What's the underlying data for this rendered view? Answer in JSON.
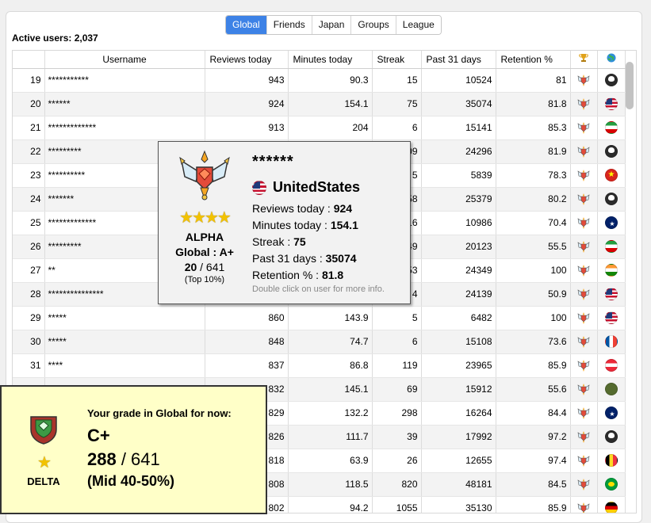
{
  "tabs": [
    "Global",
    "Friends",
    "Japan",
    "Groups",
    "League"
  ],
  "active_tab": 0,
  "active_users": "Active users: 2,037",
  "columns": [
    "",
    "Username",
    "Reviews today",
    "Minutes today",
    "Streak",
    "Past 31 days",
    "Retention %",
    "trophy-icon",
    "globe-icon"
  ],
  "rows": [
    {
      "rank": "19",
      "user": "***********",
      "reviews": "943",
      "minutes": "90.3",
      "streak": "15",
      "past31": "10524",
      "retention": "81",
      "flag": "pirate"
    },
    {
      "rank": "20",
      "user": "******",
      "reviews": "924",
      "minutes": "154.1",
      "streak": "75",
      "past31": "35074",
      "retention": "81.8",
      "flag": "us"
    },
    {
      "rank": "21",
      "user": "*************",
      "reviews": "913",
      "minutes": "204",
      "streak": "6",
      "past31": "15141",
      "retention": "85.3",
      "flag": "iran"
    },
    {
      "rank": "22",
      "user": "*********",
      "reviews": "",
      "minutes": "",
      "streak": "09",
      "past31": "24296",
      "retention": "81.9",
      "flag": "pirate"
    },
    {
      "rank": "23",
      "user": "**********",
      "reviews": "",
      "minutes": "",
      "streak": "5",
      "past31": "5839",
      "retention": "78.3",
      "flag": "vietnam"
    },
    {
      "rank": "24",
      "user": "*******",
      "reviews": "",
      "minutes": "",
      "streak": "58",
      "past31": "25379",
      "retention": "80.2",
      "flag": "pirate"
    },
    {
      "rank": "25",
      "user": "*************",
      "reviews": "",
      "minutes": "",
      "streak": "16",
      "past31": "10986",
      "retention": "70.4",
      "flag": "australia"
    },
    {
      "rank": "26",
      "user": "*********",
      "reviews": "",
      "minutes": "",
      "streak": "49",
      "past31": "20123",
      "retention": "55.5",
      "flag": "iran"
    },
    {
      "rank": "27",
      "user": "**",
      "reviews": "",
      "minutes": "",
      "streak": "53",
      "past31": "24349",
      "retention": "100",
      "flag": "india"
    },
    {
      "rank": "28",
      "user": "***************",
      "reviews": "",
      "minutes": "",
      "streak": "4",
      "past31": "24139",
      "retention": "50.9",
      "flag": "us"
    },
    {
      "rank": "29",
      "user": "*****",
      "reviews": "860",
      "minutes": "143.9",
      "streak": "5",
      "past31": "6482",
      "retention": "100",
      "flag": "us"
    },
    {
      "rank": "30",
      "user": "*****",
      "reviews": "848",
      "minutes": "74.7",
      "streak": "6",
      "past31": "15108",
      "retention": "73.6",
      "flag": "france"
    },
    {
      "rank": "31",
      "user": "****",
      "reviews": "837",
      "minutes": "86.8",
      "streak": "119",
      "past31": "23965",
      "retention": "85.9",
      "flag": "austria"
    },
    {
      "rank": "",
      "user": "",
      "reviews": "832",
      "minutes": "145.1",
      "streak": "69",
      "past31": "15912",
      "retention": "55.6",
      "flag": "army"
    },
    {
      "rank": "",
      "user": "",
      "reviews": "829",
      "minutes": "132.2",
      "streak": "298",
      "past31": "16264",
      "retention": "84.4",
      "flag": "australia"
    },
    {
      "rank": "",
      "user": "",
      "reviews": "826",
      "minutes": "111.7",
      "streak": "39",
      "past31": "17992",
      "retention": "97.2",
      "flag": "pirate"
    },
    {
      "rank": "",
      "user": "",
      "reviews": "818",
      "minutes": "63.9",
      "streak": "26",
      "past31": "12655",
      "retention": "97.4",
      "flag": "belgium"
    },
    {
      "rank": "",
      "user": "",
      "reviews": "808",
      "minutes": "118.5",
      "streak": "820",
      "past31": "48181",
      "retention": "84.5",
      "flag": "brazil"
    },
    {
      "rank": "",
      "user": "",
      "reviews": "802",
      "minutes": "94.2",
      "streak": "1055",
      "past31": "35130",
      "retention": "85.9",
      "flag": "germany"
    }
  ],
  "tooltip": {
    "name": "******",
    "country": "UnitedStates",
    "league": "ALPHA",
    "grade": "Global : A+",
    "position": "20",
    "total": "/ 641",
    "top": "(Top 10%)",
    "reviews_label": "Reviews today : ",
    "reviews": "924",
    "minutes_label": "Minutes today : ",
    "minutes": "154.1",
    "streak_label": "Streak : ",
    "streak": "75",
    "past31_label": "Past 31 days : ",
    "past31": "35074",
    "retention_label": "Retention % : ",
    "retention": "81.8",
    "hint": "Double click on user for more info.",
    "stars": "★★★★"
  },
  "grade_panel": {
    "title": "Your grade in Global for now:",
    "grade": "C+",
    "position": "288",
    "total": " / 641",
    "band": "(Mid 40-50%)",
    "league": "DELTA",
    "stars": "★"
  }
}
